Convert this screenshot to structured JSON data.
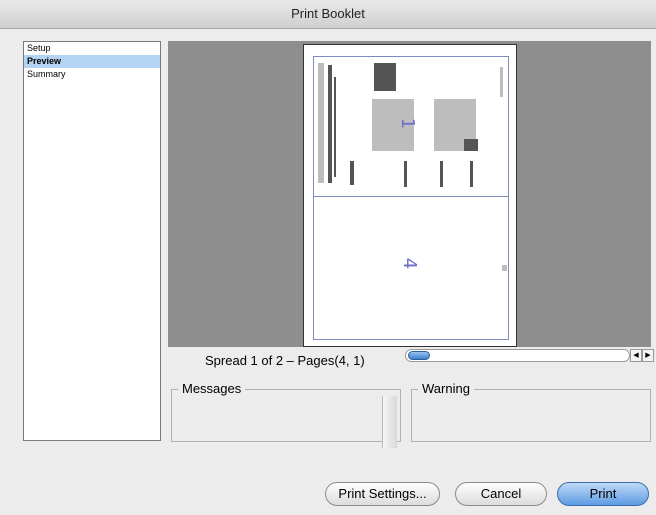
{
  "window": {
    "title": "Print Booklet"
  },
  "sidebar": {
    "items": [
      {
        "label": "Setup"
      },
      {
        "label": "Preview"
      },
      {
        "label": "Summary"
      }
    ]
  },
  "preview": {
    "spread_label": "Spread 1 of 2 – Pages(4, 1)",
    "page_top_number": "1",
    "page_bottom_number": "4"
  },
  "slider": {
    "prev_symbol": "◀",
    "next_symbol": "▶"
  },
  "messages": {
    "label": "Messages"
  },
  "warning": {
    "label": "Warning"
  },
  "buttons": {
    "print_settings": "Print Settings...",
    "cancel": "Cancel",
    "print": "Print"
  }
}
